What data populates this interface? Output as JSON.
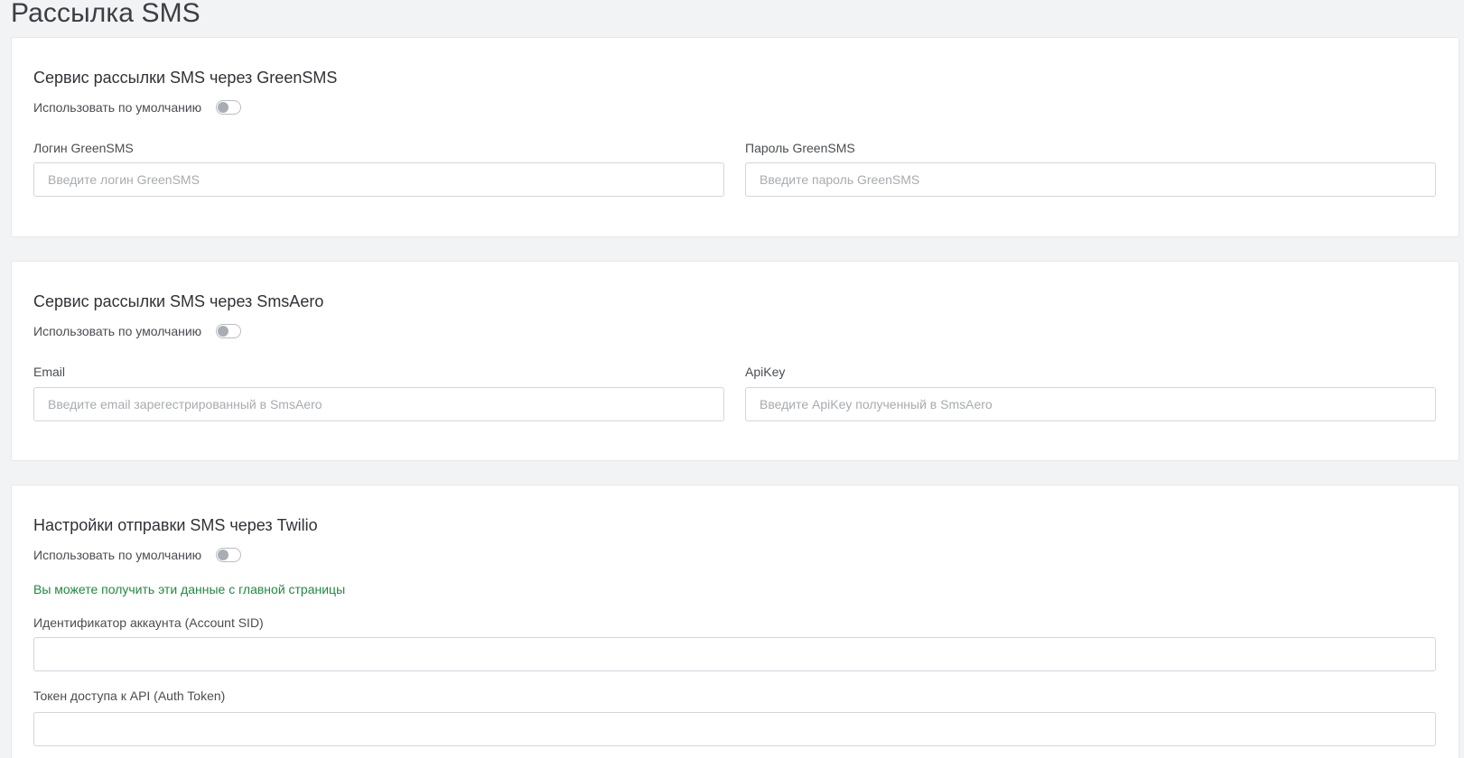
{
  "page": {
    "title": "Рассылка SMS"
  },
  "default_toggle_label": "Использовать по умолчанию",
  "greensms": {
    "title": "Сервис рассылки SMS через GreenSMS",
    "use_default": false,
    "login_label": "Логин GreenSMS",
    "login_placeholder": "Введите логин GreenSMS",
    "login_value": "",
    "password_label": "Пароль GreenSMS",
    "password_placeholder": "Введите пароль GreenSMS",
    "password_value": ""
  },
  "smsaero": {
    "title": "Сервис рассылки SMS через SmsAero",
    "use_default": false,
    "email_label": "Email",
    "email_placeholder": "Введите email зарегестрированный в SmsAero",
    "email_value": "",
    "apikey_label": "ApiKey",
    "apikey_placeholder": "Введите ApiKey полученный в SmsAero",
    "apikey_value": ""
  },
  "twilio": {
    "title": "Настройки отправки SMS через Twilio",
    "use_default": false,
    "hint": "Вы можете получить эти данные с главной страницы",
    "hint_color": "#1f8a3e",
    "account_sid_label": "Идентификатор аккаунта (Account SID)",
    "account_sid_value": "",
    "auth_token_label": "Токен доступа к API (Auth Token)",
    "auth_token_value": ""
  }
}
